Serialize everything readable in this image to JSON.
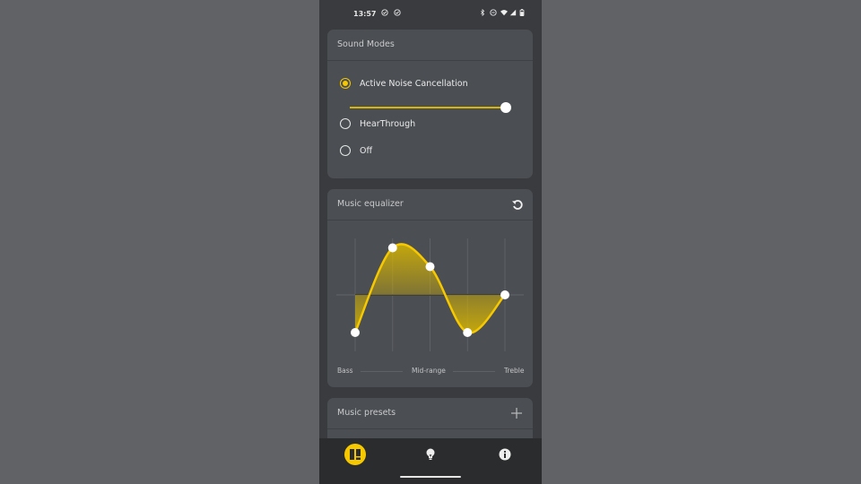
{
  "status_bar": {
    "time": "13:57",
    "left_icons": [
      "check-circle-icon",
      "check-circle-icon"
    ],
    "right_icons": [
      "bluetooth-icon",
      "do-not-disturb-icon",
      "wifi-icon",
      "signal-icon",
      "battery-icon"
    ]
  },
  "sound_modes": {
    "title": "Sound Modes",
    "options": [
      {
        "label": "Active Noise Cancellation",
        "selected": true
      },
      {
        "label": "HearThrough",
        "selected": false
      },
      {
        "label": "Off",
        "selected": false
      }
    ],
    "anc_level": 1.0
  },
  "equalizer": {
    "title": "Music equalizer",
    "reset_icon": "reset-icon",
    "axis_labels": {
      "bass": "Bass",
      "mid": "Mid-range",
      "treble": "Treble"
    },
    "accent_color": "#f5c800"
  },
  "chart_data": {
    "type": "line",
    "title": "Music equalizer",
    "bands": 5,
    "values": [
      -4,
      5,
      3,
      -4,
      0
    ],
    "ylim": [
      -6,
      6
    ],
    "xlabel_groups": [
      "Bass",
      "Mid-range",
      "Treble"
    ],
    "grid": true
  },
  "presets": {
    "title": "Music presets",
    "add_icon": "plus-icon"
  },
  "bottom_nav": {
    "items": [
      {
        "icon": "dashboard-icon",
        "active": true
      },
      {
        "icon": "lightbulb-icon",
        "active": false
      },
      {
        "icon": "info-icon",
        "active": false
      }
    ]
  }
}
